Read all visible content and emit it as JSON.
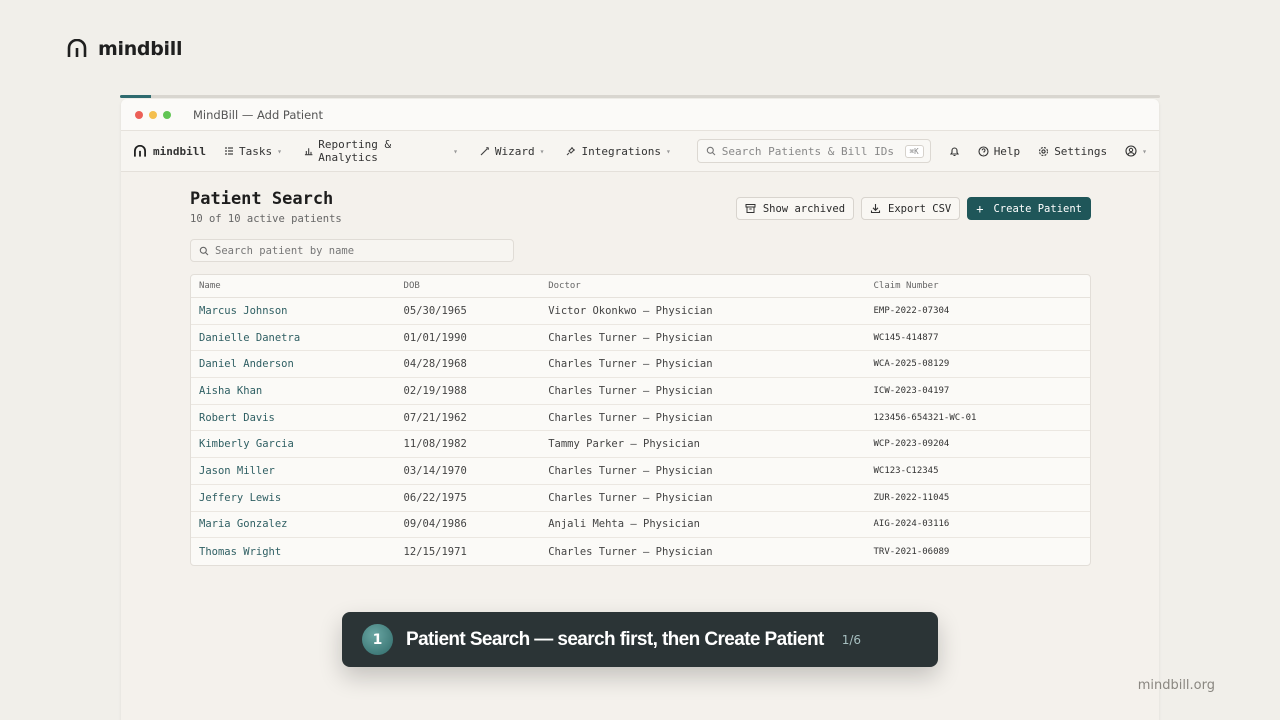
{
  "brand": {
    "name": "mindbill"
  },
  "footer": {
    "url": "mindbill.org"
  },
  "window": {
    "title": "MindBill — Add Patient",
    "progress_fraction": 0.03,
    "dot_colors": [
      "#ec5f57",
      "#f4bf4f",
      "#61c554"
    ]
  },
  "nav": {
    "logo": "mindbill",
    "items": [
      {
        "label": "Tasks",
        "icon": "tasks-icon"
      },
      {
        "label": "Reporting & Analytics",
        "icon": "bar-chart-icon"
      },
      {
        "label": "Wizard",
        "icon": "magic-wand-icon"
      },
      {
        "label": "Integrations",
        "icon": "plug-icon"
      }
    ],
    "search_placeholder": "Search Patients & Bill IDs",
    "search_shortcut": "⌘K",
    "help": "Help",
    "settings": "Settings"
  },
  "page": {
    "title": "Patient Search",
    "subtitle": "10 of 10 active patients",
    "show_archived": "Show archived",
    "export_csv": "Export CSV",
    "create_patient": "Create Patient",
    "search_placeholder": "Search patient by name"
  },
  "table": {
    "headers": [
      "Name",
      "DOB",
      "Doctor",
      "Claim Number"
    ],
    "rows": [
      [
        "Marcus Johnson",
        "05/30/1965",
        "Victor Okonkwo — Physician",
        "EMP-2022-07304"
      ],
      [
        "Danielle Danetra",
        "01/01/1990",
        "Charles Turner — Physician",
        "WC145-414877"
      ],
      [
        "Daniel Anderson",
        "04/28/1968",
        "Charles Turner — Physician",
        "WCA-2025-08129"
      ],
      [
        "Aisha Khan",
        "02/19/1988",
        "Charles Turner — Physician",
        "ICW-2023-04197"
      ],
      [
        "Robert Davis",
        "07/21/1962",
        "Charles Turner — Physician",
        "123456-654321-WC-01"
      ],
      [
        "Kimberly Garcia",
        "11/08/1982",
        "Tammy Parker — Physician",
        "WCP-2023-09204"
      ],
      [
        "Jason Miller",
        "03/14/1970",
        "Charles Turner — Physician",
        "WC123-C12345"
      ],
      [
        "Jeffery Lewis",
        "06/22/1975",
        "Charles Turner — Physician",
        "ZUR-2022-11045"
      ],
      [
        "Maria Gonzalez",
        "09/04/1986",
        "Anjali Mehta — Physician",
        "AIG-2024-03116"
      ],
      [
        "Thomas Wright",
        "12/15/1971",
        "Charles Turner — Physician",
        "TRV-2021-06089"
      ]
    ]
  },
  "toast": {
    "step": "1",
    "message": "Patient Search — search first, then Create Patient",
    "counter": "1/6"
  },
  "colors": {
    "accent": "#1f5659",
    "toast_bg": "#2b3436"
  }
}
